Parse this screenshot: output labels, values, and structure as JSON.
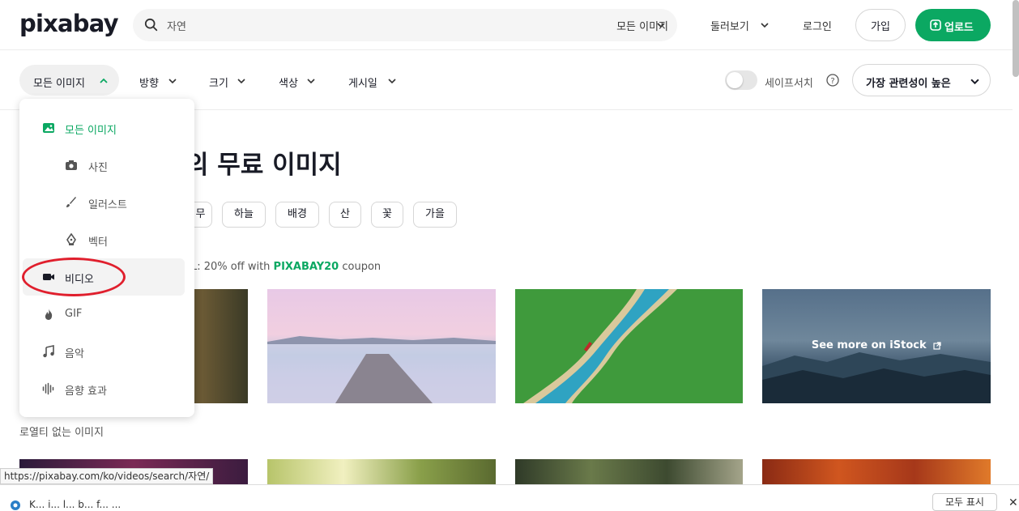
{
  "brand": {
    "logo": "pixabay",
    "accent": "#0ba862"
  },
  "header": {
    "search_value": "자연",
    "search_placeholder": "",
    "scope": "모든 이미지",
    "explore": "둘러보기",
    "login": "로그인",
    "join": "가입",
    "upload": "업로드"
  },
  "filters": {
    "type": "모든 이미지",
    "orientation": "방향",
    "size": "크기",
    "color": "색상",
    "date": "게시일",
    "safesearch": "세이프서치",
    "safesearch_on": false,
    "sort": "가장 관련성이 높은"
  },
  "dropdown": {
    "items": [
      {
        "label": "모든 이미지",
        "icon": "image-icon"
      },
      {
        "label": "사진",
        "icon": "camera-icon"
      },
      {
        "label": "일러스트",
        "icon": "brush-icon"
      },
      {
        "label": "벡터",
        "icon": "pen-tool-icon"
      },
      {
        "label": "비디오",
        "icon": "video-icon"
      },
      {
        "label": "GIF",
        "icon": "flame-icon"
      },
      {
        "label": "음악",
        "icon": "music-note-icon"
      },
      {
        "label": "음향 효과",
        "icon": "sound-wave-icon"
      }
    ]
  },
  "content": {
    "title_visible": "의 무료 이미지",
    "tags": [
      "무",
      "하늘",
      "배경",
      "산",
      "꽃",
      "가을"
    ],
    "promo_text": "L: 20% off with ",
    "promo_code": "PIXABAY20",
    "promo_suffix": " coupon",
    "istock_label": "See more on iStock",
    "caption": "로열티 없는 이미지"
  },
  "status_url": "https://pixabay.com/ko/videos/search/자연/",
  "downloads": {
    "file_label": "K... i... l... b... f... ...",
    "show_all": "모두 표시"
  }
}
